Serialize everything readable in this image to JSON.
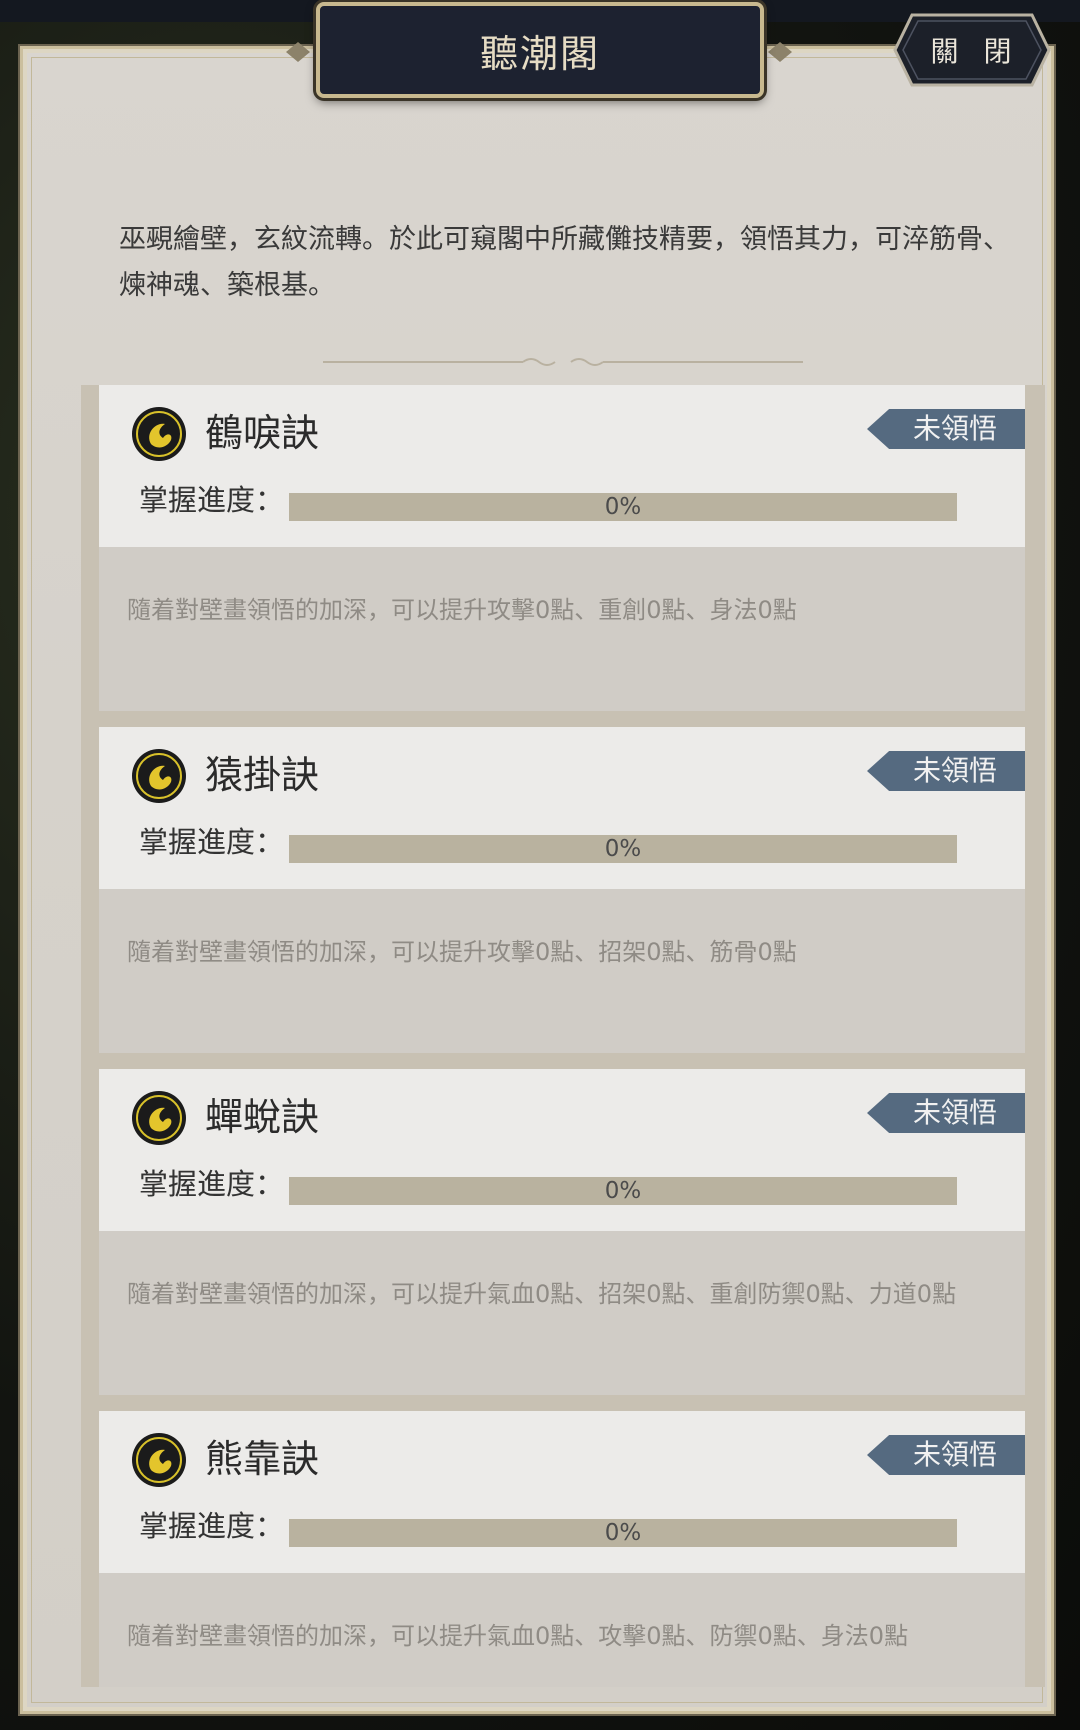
{
  "window": {
    "title": "聽潮閣",
    "close_label": "關 閉"
  },
  "intro_text": "巫覡繪壁，玄紋流轉。於此可窺閣中所藏儺技精要，領悟其力，可淬筋骨、煉神魂、築根基。",
  "progress_label": "掌握進度：",
  "status_color": "#556a80",
  "skills": [
    {
      "name": "鶴唳訣",
      "status": "未領悟",
      "progress": 0,
      "progress_text": "0%",
      "description": "隨着對壁畫領悟的加深，可以提升攻擊0點、重創0點、身法0點"
    },
    {
      "name": "猿掛訣",
      "status": "未領悟",
      "progress": 0,
      "progress_text": "0%",
      "description": "隨着對壁畫領悟的加深，可以提升攻擊0點、招架0點、筋骨0點"
    },
    {
      "name": "蟬蛻訣",
      "status": "未領悟",
      "progress": 0,
      "progress_text": "0%",
      "description": "隨着對壁畫領悟的加深，可以提升氣血0點、招架0點、重創防禦0點、力道0點"
    },
    {
      "name": "熊靠訣",
      "status": "未領悟",
      "progress": 0,
      "progress_text": "0%",
      "description": "隨着對壁畫領悟的加深，可以提升氣血0點、攻擊0點、防禦0點、身法0點"
    }
  ]
}
